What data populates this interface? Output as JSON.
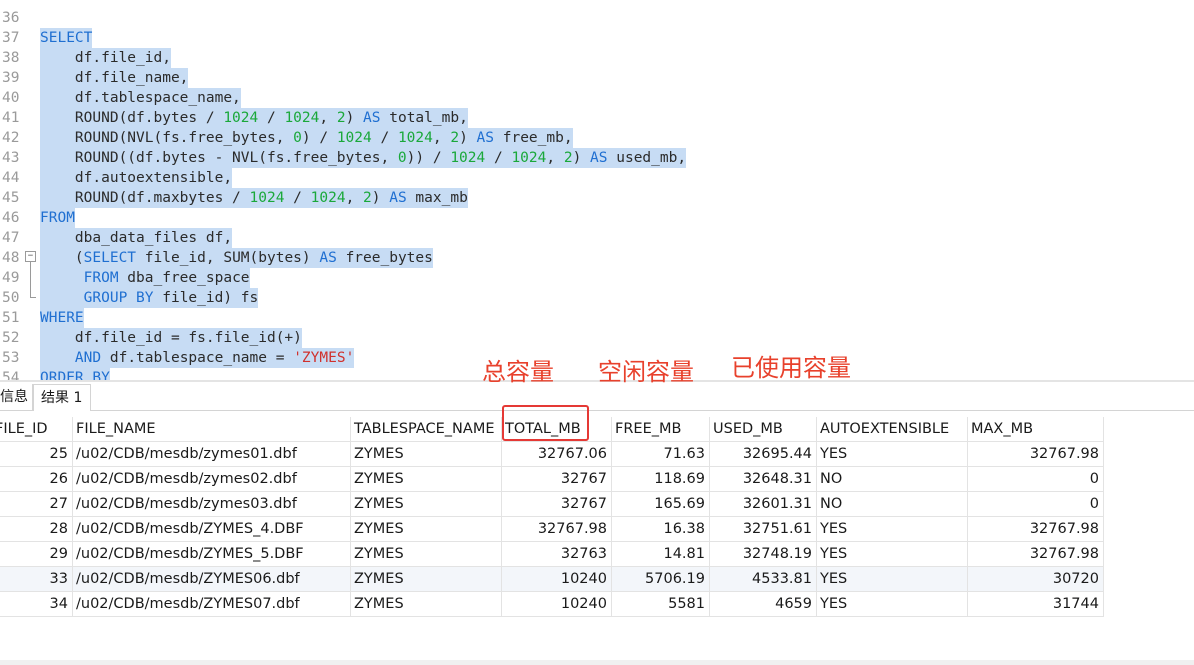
{
  "editor": {
    "lines": [
      {
        "n": "36",
        "tokens": []
      },
      {
        "n": "37",
        "sel": true,
        "tokens": [
          {
            "t": "SELECT",
            "c": "kw"
          }
        ]
      },
      {
        "n": "38",
        "sel": true,
        "tokens": [
          {
            "t": "    df.file_id,",
            "c": ""
          }
        ]
      },
      {
        "n": "39",
        "sel": true,
        "tokens": [
          {
            "t": "    df.file_name,",
            "c": ""
          }
        ]
      },
      {
        "n": "40",
        "sel": true,
        "tokens": [
          {
            "t": "    df.tablespace_name,",
            "c": ""
          }
        ]
      },
      {
        "n": "41",
        "sel": true,
        "tokens": [
          {
            "t": "    ROUND(df.bytes / ",
            "c": ""
          },
          {
            "t": "1024",
            "c": "num"
          },
          {
            "t": " / ",
            "c": ""
          },
          {
            "t": "1024",
            "c": "num"
          },
          {
            "t": ", ",
            "c": ""
          },
          {
            "t": "2",
            "c": "num"
          },
          {
            "t": ") ",
            "c": ""
          },
          {
            "t": "AS",
            "c": "kw"
          },
          {
            "t": " total_mb,",
            "c": ""
          }
        ]
      },
      {
        "n": "42",
        "sel": true,
        "tokens": [
          {
            "t": "    ROUND(NVL(fs.free_bytes, ",
            "c": ""
          },
          {
            "t": "0",
            "c": "num"
          },
          {
            "t": ") / ",
            "c": ""
          },
          {
            "t": "1024",
            "c": "num"
          },
          {
            "t": " / ",
            "c": ""
          },
          {
            "t": "1024",
            "c": "num"
          },
          {
            "t": ", ",
            "c": ""
          },
          {
            "t": "2",
            "c": "num"
          },
          {
            "t": ") ",
            "c": ""
          },
          {
            "t": "AS",
            "c": "kw"
          },
          {
            "t": " free_mb,",
            "c": ""
          }
        ]
      },
      {
        "n": "43",
        "sel": true,
        "tokens": [
          {
            "t": "    ROUND((df.bytes - NVL(fs.free_bytes, ",
            "c": ""
          },
          {
            "t": "0",
            "c": "num"
          },
          {
            "t": ")) / ",
            "c": ""
          },
          {
            "t": "1024",
            "c": "num"
          },
          {
            "t": " / ",
            "c": ""
          },
          {
            "t": "1024",
            "c": "num"
          },
          {
            "t": ", ",
            "c": ""
          },
          {
            "t": "2",
            "c": "num"
          },
          {
            "t": ") ",
            "c": ""
          },
          {
            "t": "AS",
            "c": "kw"
          },
          {
            "t": " used_mb,",
            "c": ""
          }
        ]
      },
      {
        "n": "44",
        "sel": true,
        "tokens": [
          {
            "t": "    df.autoextensible,",
            "c": ""
          }
        ]
      },
      {
        "n": "45",
        "sel": true,
        "tokens": [
          {
            "t": "    ROUND(df.maxbytes / ",
            "c": ""
          },
          {
            "t": "1024",
            "c": "num"
          },
          {
            "t": " / ",
            "c": ""
          },
          {
            "t": "1024",
            "c": "num"
          },
          {
            "t": ", ",
            "c": ""
          },
          {
            "t": "2",
            "c": "num"
          },
          {
            "t": ") ",
            "c": ""
          },
          {
            "t": "AS",
            "c": "kw"
          },
          {
            "t": " max_mb",
            "c": ""
          }
        ]
      },
      {
        "n": "46",
        "sel": true,
        "tokens": [
          {
            "t": "FROM",
            "c": "kw"
          }
        ]
      },
      {
        "n": "47",
        "sel": true,
        "tokens": [
          {
            "t": "    dba_data_files df,",
            "c": ""
          }
        ]
      },
      {
        "n": "48",
        "sel": true,
        "tokens": [
          {
            "t": "    (",
            "c": ""
          },
          {
            "t": "SELECT",
            "c": "kw"
          },
          {
            "t": " file_id, SUM(bytes) ",
            "c": ""
          },
          {
            "t": "AS",
            "c": "kw"
          },
          {
            "t": " free_bytes",
            "c": ""
          }
        ]
      },
      {
        "n": "49",
        "sel": true,
        "tokens": [
          {
            "t": "     ",
            "c": ""
          },
          {
            "t": "FROM",
            "c": "kw"
          },
          {
            "t": " dba_free_space",
            "c": ""
          }
        ]
      },
      {
        "n": "50",
        "sel": true,
        "tokens": [
          {
            "t": "     ",
            "c": ""
          },
          {
            "t": "GROUP BY",
            "c": "kw"
          },
          {
            "t": " file_id) fs",
            "c": ""
          }
        ]
      },
      {
        "n": "51",
        "sel": true,
        "tokens": [
          {
            "t": "WHERE",
            "c": "kw"
          }
        ]
      },
      {
        "n": "52",
        "sel": true,
        "tokens": [
          {
            "t": "    df.file_id = fs.file_id(+)",
            "c": ""
          }
        ]
      },
      {
        "n": "53",
        "sel": true,
        "tokens": [
          {
            "t": "    ",
            "c": ""
          },
          {
            "t": "AND",
            "c": "kw"
          },
          {
            "t": " df.tablespace_name = ",
            "c": ""
          },
          {
            "t": "'ZYMES'",
            "c": "str"
          }
        ]
      },
      {
        "n": "54",
        "sel": true,
        "tokens": [
          {
            "t": "ORDER BY",
            "c": "kw"
          }
        ]
      }
    ]
  },
  "annotations": {
    "total": "总容量",
    "free": "空闲容量",
    "used": "已使用容量"
  },
  "result_tabs": {
    "messages": "信息",
    "result1": "结果 1"
  },
  "table": {
    "columns": [
      "FILE_ID",
      "FILE_NAME",
      "TABLESPACE_NAME",
      "TOTAL_MB",
      "FREE_MB",
      "USED_MB",
      "AUTOEXTENSIBLE",
      "MAX_MB"
    ],
    "rows": [
      [
        "25",
        "/u02/CDB/mesdb/zymes01.dbf",
        "ZYMES",
        "32767.06",
        "71.63",
        "32695.44",
        "YES",
        "32767.98"
      ],
      [
        "26",
        "/u02/CDB/mesdb/zymes02.dbf",
        "ZYMES",
        "32767",
        "118.69",
        "32648.31",
        "NO",
        "0"
      ],
      [
        "27",
        "/u02/CDB/mesdb/zymes03.dbf",
        "ZYMES",
        "32767",
        "165.69",
        "32601.31",
        "NO",
        "0"
      ],
      [
        "28",
        "/u02/CDB/mesdb/ZYMES_4.DBF",
        "ZYMES",
        "32767.98",
        "16.38",
        "32751.61",
        "YES",
        "32767.98"
      ],
      [
        "29",
        "/u02/CDB/mesdb/ZYMES_5.DBF",
        "ZYMES",
        "32763",
        "14.81",
        "32748.19",
        "YES",
        "32767.98"
      ],
      [
        "33",
        "/u02/CDB/mesdb/ZYMES06.dbf",
        "ZYMES",
        "10240",
        "5706.19",
        "4533.81",
        "YES",
        "30720"
      ],
      [
        "34",
        "/u02/CDB/mesdb/ZYMES07.dbf",
        "ZYMES",
        "10240",
        "5581",
        "4659",
        "YES",
        "31744"
      ]
    ]
  },
  "colors": {
    "selection": "#c7dcf4",
    "keyword": "#1f6fd1",
    "number": "#1aa83a",
    "string": "#d0312d",
    "annotation": "#e8412c"
  }
}
